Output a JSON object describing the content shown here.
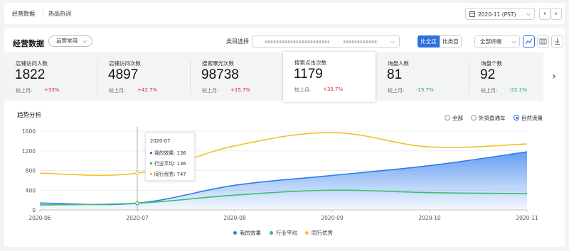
{
  "header": {
    "tabs": [
      {
        "label": "经营数据"
      },
      {
        "label": "热品热词"
      }
    ],
    "date": "2020-11 (PST)"
  },
  "panel": {
    "title": "经营数据",
    "scope": "运营常用",
    "category_label": "类目选择",
    "compare": [
      {
        "label": "比全店"
      },
      {
        "label": "比类目"
      }
    ],
    "terminal": "全部终端"
  },
  "kpis": [
    {
      "label": "店铺访问人数",
      "value": "1822",
      "mom_label": "较上月:",
      "change": "+33%",
      "trend": "up"
    },
    {
      "label": "店铺访问次数",
      "value": "4897",
      "mom_label": "较上月:",
      "change": "+42.7%",
      "trend": "up"
    },
    {
      "label": "搜索曝光次数",
      "value": "98738",
      "mom_label": "较上月:",
      "change": "+15.7%",
      "trend": "up"
    },
    {
      "label": "搜索点击次数",
      "value": "1179",
      "mom_label": "较上月:",
      "change": "+30.7%",
      "trend": "up"
    },
    {
      "label": "询盘人数",
      "value": "81",
      "mom_label": "较上月:",
      "change": "-15.7%",
      "trend": "down"
    },
    {
      "label": "询盘个数",
      "value": "92",
      "mom_label": "较上月:",
      "change": "-22.1%",
      "trend": "down"
    }
  ],
  "trend": {
    "title": "趋势分析",
    "filters": [
      {
        "label": "全部",
        "selected": false
      },
      {
        "label": "外贸直通车",
        "selected": false
      },
      {
        "label": "自然流量",
        "selected": true
      }
    ]
  },
  "tooltip": {
    "title": "2020-07",
    "rows": [
      {
        "text": "我的效果: 136",
        "color": "#2f7be8"
      },
      {
        "text": "行业平均: 136",
        "color": "#3dbd6a"
      },
      {
        "text": "同行优秀: 747",
        "color": "#f2c12e"
      }
    ]
  },
  "chart_data": {
    "type": "line",
    "title": "趋势分析",
    "x": [
      "2020-06",
      "2020-07",
      "2020-08",
      "2020-09",
      "2020-10",
      "2020-11"
    ],
    "yticks": [
      0,
      400,
      800,
      1200,
      1600
    ],
    "ylim": [
      0,
      1600
    ],
    "grid": true,
    "legend_position": "bottom",
    "series": [
      {
        "name": "我的效果",
        "color": "#2f7be8",
        "area": true,
        "values": [
          140,
          136,
          500,
          700,
          900,
          1179
        ]
      },
      {
        "name": "行业平均",
        "color": "#3dbd6a",
        "area": false,
        "values": [
          100,
          136,
          300,
          400,
          350,
          330
        ]
      },
      {
        "name": "同行优秀",
        "color": "#f2c12e",
        "area": false,
        "values": [
          747,
          747,
          1300,
          1570,
          1280,
          1340
        ]
      }
    ]
  }
}
